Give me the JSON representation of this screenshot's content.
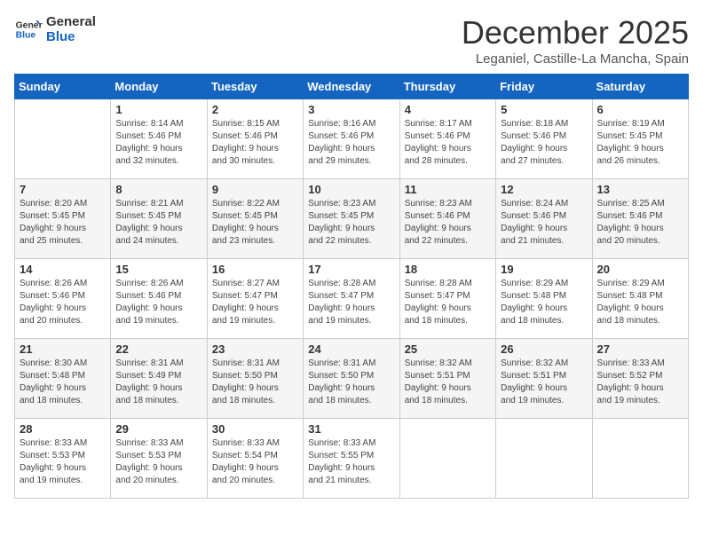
{
  "header": {
    "logo_line1": "General",
    "logo_line2": "Blue",
    "title": "December 2025",
    "subtitle": "Leganiel, Castille-La Mancha, Spain"
  },
  "columns": [
    "Sunday",
    "Monday",
    "Tuesday",
    "Wednesday",
    "Thursday",
    "Friday",
    "Saturday"
  ],
  "weeks": [
    [
      {
        "day": "",
        "info": ""
      },
      {
        "day": "1",
        "info": "Sunrise: 8:14 AM\nSunset: 5:46 PM\nDaylight: 9 hours\nand 32 minutes."
      },
      {
        "day": "2",
        "info": "Sunrise: 8:15 AM\nSunset: 5:46 PM\nDaylight: 9 hours\nand 30 minutes."
      },
      {
        "day": "3",
        "info": "Sunrise: 8:16 AM\nSunset: 5:46 PM\nDaylight: 9 hours\nand 29 minutes."
      },
      {
        "day": "4",
        "info": "Sunrise: 8:17 AM\nSunset: 5:46 PM\nDaylight: 9 hours\nand 28 minutes."
      },
      {
        "day": "5",
        "info": "Sunrise: 8:18 AM\nSunset: 5:46 PM\nDaylight: 9 hours\nand 27 minutes."
      },
      {
        "day": "6",
        "info": "Sunrise: 8:19 AM\nSunset: 5:45 PM\nDaylight: 9 hours\nand 26 minutes."
      }
    ],
    [
      {
        "day": "7",
        "info": "Sunrise: 8:20 AM\nSunset: 5:45 PM\nDaylight: 9 hours\nand 25 minutes."
      },
      {
        "day": "8",
        "info": "Sunrise: 8:21 AM\nSunset: 5:45 PM\nDaylight: 9 hours\nand 24 minutes."
      },
      {
        "day": "9",
        "info": "Sunrise: 8:22 AM\nSunset: 5:45 PM\nDaylight: 9 hours\nand 23 minutes."
      },
      {
        "day": "10",
        "info": "Sunrise: 8:23 AM\nSunset: 5:45 PM\nDaylight: 9 hours\nand 22 minutes."
      },
      {
        "day": "11",
        "info": "Sunrise: 8:23 AM\nSunset: 5:46 PM\nDaylight: 9 hours\nand 22 minutes."
      },
      {
        "day": "12",
        "info": "Sunrise: 8:24 AM\nSunset: 5:46 PM\nDaylight: 9 hours\nand 21 minutes."
      },
      {
        "day": "13",
        "info": "Sunrise: 8:25 AM\nSunset: 5:46 PM\nDaylight: 9 hours\nand 20 minutes."
      }
    ],
    [
      {
        "day": "14",
        "info": "Sunrise: 8:26 AM\nSunset: 5:46 PM\nDaylight: 9 hours\nand 20 minutes."
      },
      {
        "day": "15",
        "info": "Sunrise: 8:26 AM\nSunset: 5:46 PM\nDaylight: 9 hours\nand 19 minutes."
      },
      {
        "day": "16",
        "info": "Sunrise: 8:27 AM\nSunset: 5:47 PM\nDaylight: 9 hours\nand 19 minutes."
      },
      {
        "day": "17",
        "info": "Sunrise: 8:28 AM\nSunset: 5:47 PM\nDaylight: 9 hours\nand 19 minutes."
      },
      {
        "day": "18",
        "info": "Sunrise: 8:28 AM\nSunset: 5:47 PM\nDaylight: 9 hours\nand 18 minutes."
      },
      {
        "day": "19",
        "info": "Sunrise: 8:29 AM\nSunset: 5:48 PM\nDaylight: 9 hours\nand 18 minutes."
      },
      {
        "day": "20",
        "info": "Sunrise: 8:29 AM\nSunset: 5:48 PM\nDaylight: 9 hours\nand 18 minutes."
      }
    ],
    [
      {
        "day": "21",
        "info": "Sunrise: 8:30 AM\nSunset: 5:48 PM\nDaylight: 9 hours\nand 18 minutes."
      },
      {
        "day": "22",
        "info": "Sunrise: 8:31 AM\nSunset: 5:49 PM\nDaylight: 9 hours\nand 18 minutes."
      },
      {
        "day": "23",
        "info": "Sunrise: 8:31 AM\nSunset: 5:50 PM\nDaylight: 9 hours\nand 18 minutes."
      },
      {
        "day": "24",
        "info": "Sunrise: 8:31 AM\nSunset: 5:50 PM\nDaylight: 9 hours\nand 18 minutes."
      },
      {
        "day": "25",
        "info": "Sunrise: 8:32 AM\nSunset: 5:51 PM\nDaylight: 9 hours\nand 18 minutes."
      },
      {
        "day": "26",
        "info": "Sunrise: 8:32 AM\nSunset: 5:51 PM\nDaylight: 9 hours\nand 19 minutes."
      },
      {
        "day": "27",
        "info": "Sunrise: 8:33 AM\nSunset: 5:52 PM\nDaylight: 9 hours\nand 19 minutes."
      }
    ],
    [
      {
        "day": "28",
        "info": "Sunrise: 8:33 AM\nSunset: 5:53 PM\nDaylight: 9 hours\nand 19 minutes."
      },
      {
        "day": "29",
        "info": "Sunrise: 8:33 AM\nSunset: 5:53 PM\nDaylight: 9 hours\nand 20 minutes."
      },
      {
        "day": "30",
        "info": "Sunrise: 8:33 AM\nSunset: 5:54 PM\nDaylight: 9 hours\nand 20 minutes."
      },
      {
        "day": "31",
        "info": "Sunrise: 8:33 AM\nSunset: 5:55 PM\nDaylight: 9 hours\nand 21 minutes."
      },
      {
        "day": "",
        "info": ""
      },
      {
        "day": "",
        "info": ""
      },
      {
        "day": "",
        "info": ""
      }
    ]
  ]
}
